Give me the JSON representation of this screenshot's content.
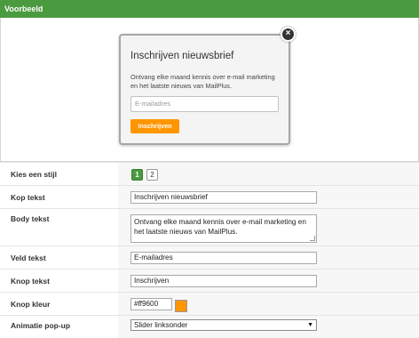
{
  "header": {
    "title": "Voorbeeld"
  },
  "popup": {
    "title": "Inschrijven nieuwsbrief",
    "body": "Ontvang elke maand kennis over e-mail marketing en het laatste nieuws van MailPlus.",
    "field_placeholder": "E-mailadres",
    "button_label": "Inschrijven",
    "close_symbol": "×",
    "close_icon": "close-icon"
  },
  "form": {
    "style": {
      "label": "Kies een stijl",
      "options": [
        "1",
        "2"
      ],
      "selected": "1"
    },
    "kop_tekst": {
      "label": "Kop tekst",
      "value": "Inschrijven nieuwsbrief"
    },
    "body_tekst": {
      "label": "Body tekst",
      "value": "Ontvang elke maand kennis over e-mail marketing en het laatste nieuws van MailPlus."
    },
    "veld_tekst": {
      "label": "Veld tekst",
      "value": "E-mailadres"
    },
    "knop_tekst": {
      "label": "Knop tekst",
      "value": "Inschrijven"
    },
    "knop_kleur": {
      "label": "Knop kleur",
      "value": "#ff9600"
    },
    "animatie": {
      "label": "Animatie pop-up",
      "selected": "Slider linksonder",
      "arrow": "▼"
    }
  },
  "colors": {
    "header_green": "#4a9a3f",
    "button_orange": "#ff9600"
  }
}
